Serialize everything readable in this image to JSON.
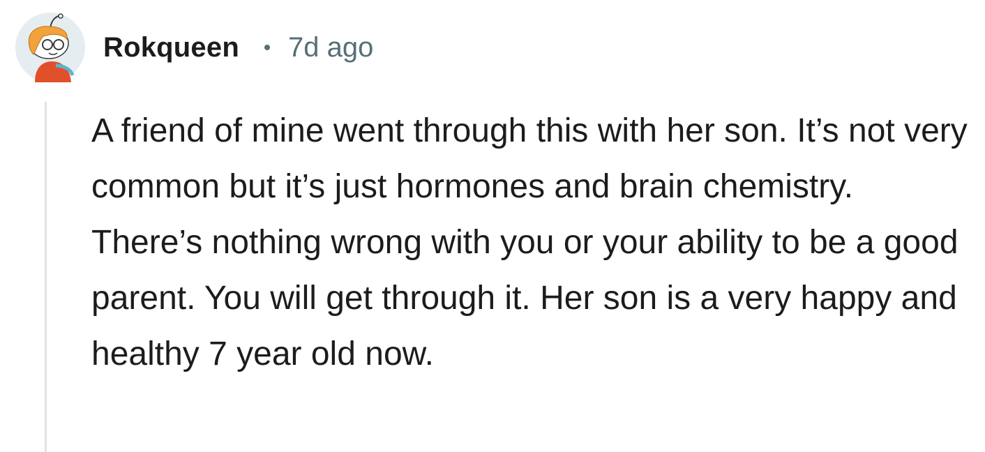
{
  "comment": {
    "author": "Rokqueen",
    "separator_icon": "dot-separator",
    "timestamp": "7d ago",
    "avatar_icon": "snoo-avatar",
    "body": "A friend of mine went through this with her son. It’s not very common but it’s just hormones and brain chemistry. There’s nothing wrong with you or your ability to be a good parent. You will get through it. Her son is a very happy and healthy 7 year old now."
  },
  "colors": {
    "text": "#1c1c1c",
    "meta": "#576f76",
    "thread_line": "#dfe3e5"
  }
}
